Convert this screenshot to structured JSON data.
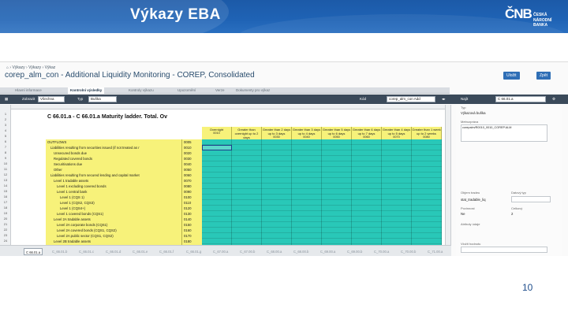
{
  "banner": {
    "title": "Výkazy EBA",
    "logo_mark": "ČNB",
    "logo_line1": "ČESKÁ",
    "logo_line2": "NÁRODNÍ BANKA"
  },
  "app": {
    "breadcrumbs": [
      "Výkazy",
      "Výkazy",
      "Výkaz"
    ],
    "doc_title": "corep_alm_con - Additional Liquidity Monitoring - COREP, Consolidated",
    "buttons": {
      "close": "Uložit",
      "back": "Zpět"
    },
    "tabs": [
      "Hlavní informace",
      "Kontrolní výsledky",
      "Kontroly výkazu",
      "Upozornění",
      "Verze",
      "Dokumenty pro výkaz"
    ],
    "toolbar": {
      "label1": "Zobrazit",
      "value1": "Všechna",
      "label2": "Typ",
      "value2": "Buňka",
      "label3": "Kód",
      "value3": "corep_alm_con Add",
      "label4": "Najít",
      "value4": "C 66.01.a"
    },
    "sheet": {
      "title": "C 66.01.a - C 66.01.a Maturity ladder. Total. Ov",
      "row_numbers": [
        "1",
        "2",
        "3",
        "4",
        "5",
        "6",
        "7",
        "8",
        "9",
        "10",
        "11",
        "12",
        "13",
        "14",
        "15",
        "16",
        "17",
        "18",
        "19",
        "20",
        "21",
        "22",
        "23",
        "24",
        "25"
      ],
      "column_headers": [
        {
          "label": "Overnight",
          "code": "0010"
        },
        {
          "label": "Greater than overnight up to 2 days",
          "code": "0020"
        },
        {
          "label": "Greater than 2 days up to 3 days",
          "code": "0030"
        },
        {
          "label": "Greater than 3 days up to 4 days",
          "code": "0040"
        },
        {
          "label": "Greater than 5 days up to 6 days",
          "code": "0050"
        },
        {
          "label": "Greater than 6 days up to 7 days",
          "code": "0060"
        },
        {
          "label": "Greater than 4 days up to 5 days",
          "code": "0070"
        },
        {
          "label": "Greater than 1 week up to 2 weeks",
          "code": "0080"
        }
      ],
      "rows": [
        {
          "label": "OUTFLOWS",
          "code": "0005",
          "indent": 0
        },
        {
          "label": "Liabilities resulting from securities issued (if not treated as r",
          "code": "0010",
          "indent": 1
        },
        {
          "label": "Unsecured bonds due",
          "code": "0020",
          "indent": 2
        },
        {
          "label": "Regulated covered bonds",
          "code": "0030",
          "indent": 2
        },
        {
          "label": "Securitisations due",
          "code": "0040",
          "indent": 2
        },
        {
          "label": "Other",
          "code": "0050",
          "indent": 2
        },
        {
          "label": "Liabilities resulting from secured lending and capital market",
          "code": "0060",
          "indent": 1
        },
        {
          "label": "Level 1 tradable assets",
          "code": "0070",
          "indent": 2
        },
        {
          "label": "Level 1 excluding covered bonds",
          "code": "0080",
          "indent": 3
        },
        {
          "label": "Level 1 central bank",
          "code": "0090",
          "indent": 3
        },
        {
          "label": "Level 1 (CQS 1)",
          "code": "0100",
          "indent": 4
        },
        {
          "label": "Level 1 (CQS2, CQS3)",
          "code": "0110",
          "indent": 4
        },
        {
          "label": "Level 1 (CQS4+)",
          "code": "0120",
          "indent": 4
        },
        {
          "label": "Level 1 covered bonds (CQS1)",
          "code": "0130",
          "indent": 3
        },
        {
          "label": "Level 2A tradable assets",
          "code": "0140",
          "indent": 2
        },
        {
          "label": "Level 2A corporate bonds (CQS1)",
          "code": "0150",
          "indent": 3
        },
        {
          "label": "Level 2A covered bonds (CQS1, CQS2)",
          "code": "0160",
          "indent": 3
        },
        {
          "label": "Level 2A public sector (CQS1, CQS2)",
          "code": "0170",
          "indent": 3
        },
        {
          "label": "Level 2B tradable assets",
          "code": "0180",
          "indent": 2
        }
      ],
      "sheet_tabs": [
        "C 66.01.a",
        "C_66.01.b",
        "C_66.01.c",
        "C_66.01.d",
        "C_66.01.e",
        "C_66.01.f",
        "C_66.01.g",
        "C_67.00.a",
        "C_67.00.b",
        "C_68.00.a",
        "C_68.00.b",
        "C_69.00.a",
        "C_69.00.b",
        "C_70.00.a",
        "C_70.00.b",
        "C_71.00.a"
      ]
    },
    "panel": {
      "label_type": "Typ",
      "value_type": "Výkazová buňka",
      "label_name": "Metrozpráva",
      "value_name": "corepalm/R0010_0010_COREP.ALM",
      "label_owner": "Objem tradeu",
      "value_owner": "stat_tradable_liq",
      "label_datatype": "Datový typ",
      "label_required": "Povinnost",
      "value_required": "Ne",
      "label_precision": "Celkový",
      "value_precision": "2",
      "label_attr": "Atributy údaje",
      "label_value": "Vložit hodnotu"
    },
    "page_number": "10"
  }
}
